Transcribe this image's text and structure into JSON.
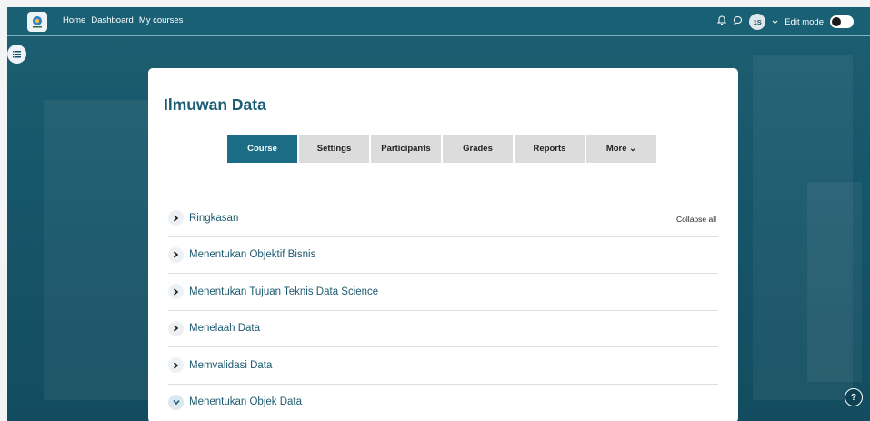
{
  "navbar": {
    "links": [
      "Home",
      "Dashboard",
      "My courses"
    ],
    "avatar_initials": "1S",
    "edit_mode_label": "Edit mode"
  },
  "course": {
    "title": "Ilmuwan Data"
  },
  "tabs": [
    {
      "label": "Course",
      "active": true
    },
    {
      "label": "Settings",
      "active": false
    },
    {
      "label": "Participants",
      "active": false
    },
    {
      "label": "Grades",
      "active": false
    },
    {
      "label": "Reports",
      "active": false
    },
    {
      "label": "More ⌄",
      "active": false
    }
  ],
  "collapse_all_label": "Collapse all",
  "sections": [
    {
      "label": "Ringkasan",
      "state": "collapsed"
    },
    {
      "label": "Menentukan Objektif Bisnis",
      "state": "collapsed"
    },
    {
      "label": "Menentukan Tujuan Teknis Data Science",
      "state": "collapsed"
    },
    {
      "label": "Menelaah Data",
      "state": "collapsed"
    },
    {
      "label": "Memvalidasi Data",
      "state": "collapsed"
    },
    {
      "label": "Menentukan Objek Data",
      "state": "expanded"
    }
  ],
  "help_label": "?",
  "colors": {
    "navbar": "#1a6075",
    "accent": "#1b6d86",
    "title": "#1a5c72"
  },
  "icons": [
    "logo-icon",
    "bell-icon",
    "chat-icon",
    "chevron-down-icon",
    "drawer-list-icon",
    "chevron-right-icon",
    "help-icon"
  ]
}
